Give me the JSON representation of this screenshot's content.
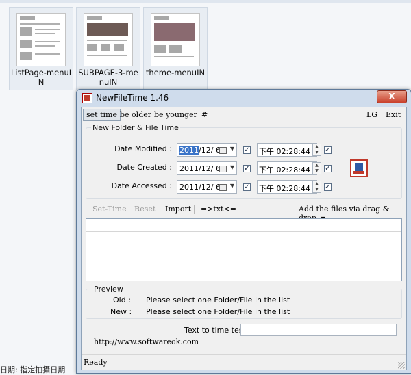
{
  "explorer": {
    "thumbnails": [
      {
        "caption": "ListPage-menuIN"
      },
      {
        "caption": "SUBPAGE-3-menuIN"
      },
      {
        "caption": "theme-menuIN"
      }
    ],
    "status_left": "日期: 指定拍攝日期"
  },
  "window": {
    "title": "NewFileTime 1.46",
    "close_label": "X",
    "menu": {
      "set_time": "set time",
      "be_older": "be older",
      "be_younger": "be younger",
      "hash": "#",
      "lg": "LG",
      "exit": "Exit"
    },
    "group_title": "New Folder & File Time",
    "rows": [
      {
        "label": "Date Modified :",
        "date_sel": "2011",
        "date_rest": "/12/  6",
        "time": "下午 02:28:44",
        "date_checked": true,
        "time_checked": true
      },
      {
        "label": "Date Created :",
        "date_sel": "",
        "date_rest": "2011/12/  6",
        "time": "下午 02:28:44",
        "date_checked": true,
        "time_checked": true
      },
      {
        "label": "Date Accessed :",
        "date_sel": "",
        "date_rest": "2011/12/  6",
        "time": "下午 02:28:44",
        "date_checked": true,
        "time_checked": true
      }
    ],
    "toolbar": {
      "set_time": "Set-Time",
      "reset": "Reset",
      "import": "Import",
      "txt": "=>txt<=",
      "add_files": "Add the files via drag & drop"
    },
    "preview": {
      "title": "Preview",
      "old_label": "Old :",
      "old_value": "Please select one Folder/File in the list",
      "new_label": "New :",
      "new_value": "Please select one Folder/File in the list"
    },
    "tester": {
      "label": "Text to time tester",
      "value": ""
    },
    "url": "http://www.softwareok.com",
    "status": "Ready"
  }
}
